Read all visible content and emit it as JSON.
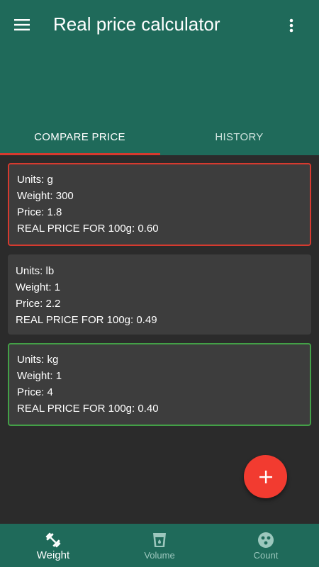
{
  "app": {
    "title": "Real price calculator",
    "menu_icon": "hamburger-menu-icon",
    "more_icon": "more-vertical-icon"
  },
  "tabs": [
    {
      "label": "COMPARE PRICE",
      "active": true
    },
    {
      "label": "HISTORY",
      "active": false
    }
  ],
  "cards": [
    {
      "units": "Units: g",
      "weight": "Weight: 300",
      "price": "Price: 1.8",
      "real_price": "REAL PRICE FOR 100g: 0.60",
      "highlight": "red"
    },
    {
      "units": "Units: lb",
      "weight": "Weight: 1",
      "price": "Price: 2.2",
      "real_price": "REAL PRICE FOR 100g: 0.49",
      "highlight": "none"
    },
    {
      "units": "Units: kg",
      "weight": "Weight: 1",
      "price": "Price: 4",
      "real_price": "REAL PRICE FOR 100g: 0.40",
      "highlight": "green"
    }
  ],
  "fab": {
    "icon": "plus-icon"
  },
  "bottom_nav": [
    {
      "label": "Weight",
      "icon": "dumbbell-icon",
      "active": true
    },
    {
      "label": "Volume",
      "icon": "glass-icon",
      "active": false
    },
    {
      "label": "Count",
      "icon": "count-circles-icon",
      "active": false
    }
  ],
  "colors": {
    "primary": "#1f6a5a",
    "accent": "#f23b30",
    "highlight_red": "#d63a2f",
    "highlight_green": "#43a047",
    "card_bg": "#3d3d3d",
    "page_bg": "#2b2b2b"
  }
}
